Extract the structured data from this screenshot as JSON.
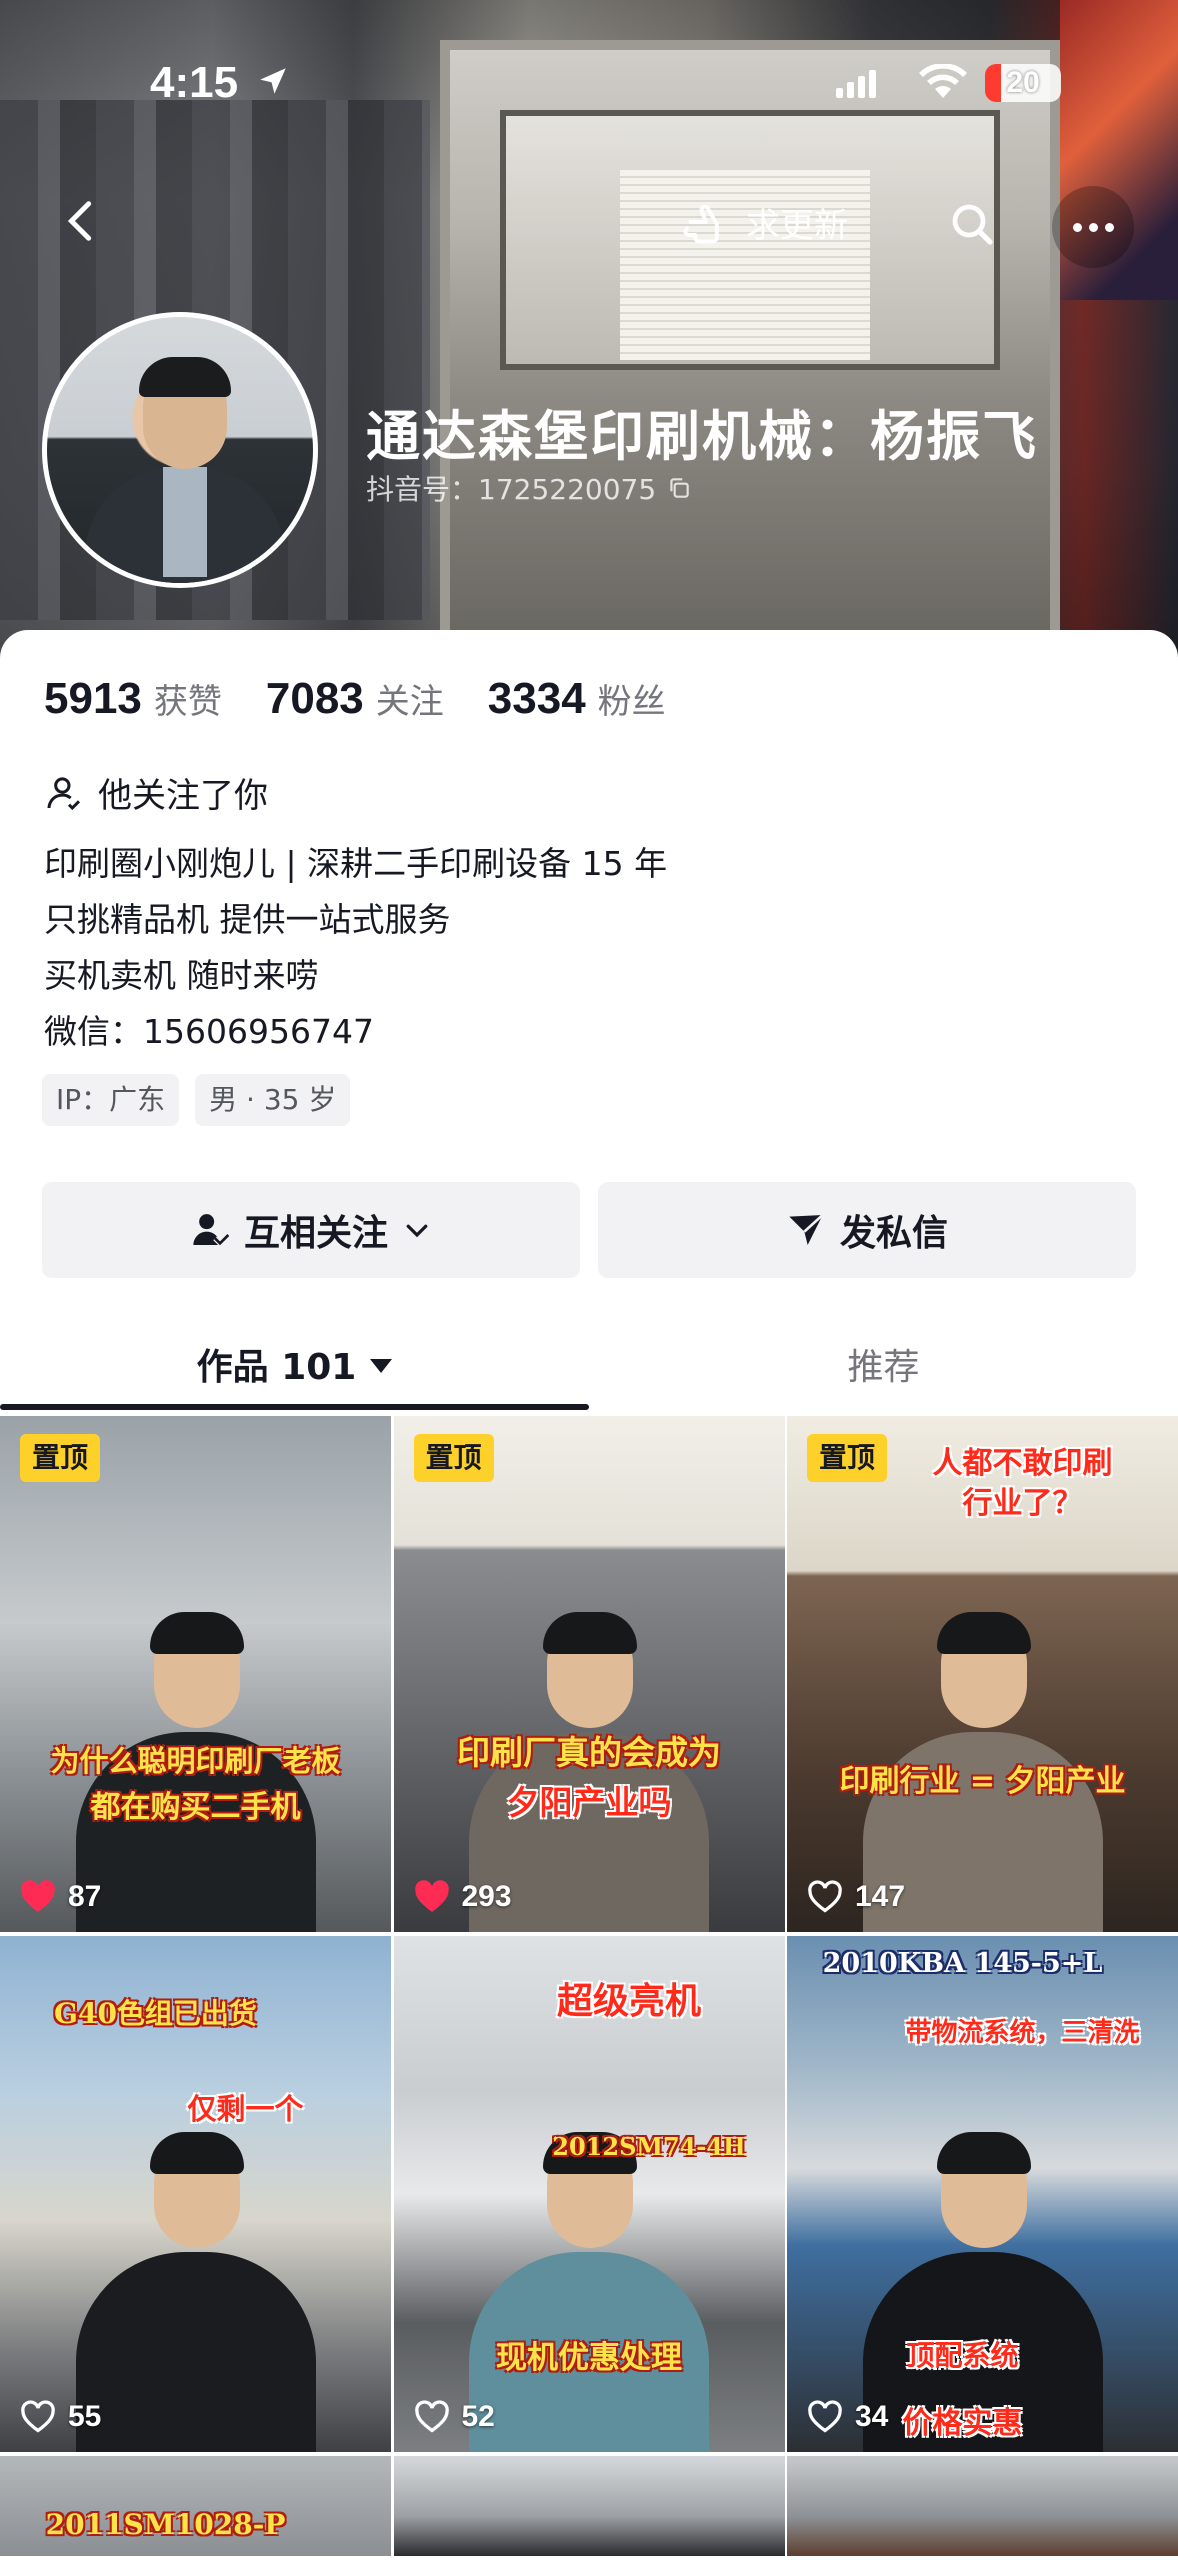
{
  "status_bar": {
    "time": "4:15",
    "battery": "20"
  },
  "header": {
    "update_label": "求更新",
    "nickname": "通达森堡印刷机械：杨振飞",
    "douyin_id": "抖音号：1725220075"
  },
  "stats": [
    {
      "value": "5913",
      "label": "获赞"
    },
    {
      "value": "7083",
      "label": "关注"
    },
    {
      "value": "3334",
      "label": "粉丝"
    }
  ],
  "follows_you": "他关注了你",
  "bio": [
    "印刷圈小刚炮儿 | 深耕二手印刷设备 15 年",
    "只挑精品机 提供一站式服务",
    "买机卖机 随时来唠",
    "微信：15606956747"
  ],
  "tags": [
    "IP：广东",
    "男 · 35 岁"
  ],
  "actions": {
    "follow_label": "互相关注",
    "message_label": "发私信"
  },
  "tabs": {
    "works_label": "作品 101",
    "recommend_label": "推荐"
  },
  "videos": [
    {
      "pinned": "置顶",
      "caption_1": "为什么聪明印刷厂老板",
      "caption_2": "都在购买二手机",
      "likes": "87",
      "liked": true
    },
    {
      "pinned": "置顶",
      "caption_1": "印刷厂真的会成为",
      "caption_2": "夕阳产业吗",
      "likes": "293",
      "liked": true
    },
    {
      "pinned": "置顶",
      "caption_1": "人都不敢印刷",
      "caption_2": "行业了？",
      "caption_3": "印刷行业 = 夕阳产业",
      "likes": "147",
      "liked": false
    },
    {
      "caption_1": "G40色组已出货",
      "caption_2": "仅剩一个",
      "likes": "55",
      "liked": false
    },
    {
      "caption_1": "超级亮机",
      "caption_2": "2012SM74-4H",
      "caption_3": "现机优惠处理",
      "likes": "52",
      "liked": false
    },
    {
      "caption_1": "2010KBA 145-5+L",
      "caption_2": "带物流系统，三清洗",
      "caption_3": "顶配系统",
      "caption_4": "价格实惠",
      "likes": "34",
      "liked": false
    },
    {
      "caption_1": "2011SM1028-P"
    },
    {},
    {}
  ],
  "colors": {
    "accent_red": "#fe2c55",
    "pin_yellow": "#fdd12a",
    "text_primary": "#161823",
    "text_secondary": "#75767d"
  }
}
